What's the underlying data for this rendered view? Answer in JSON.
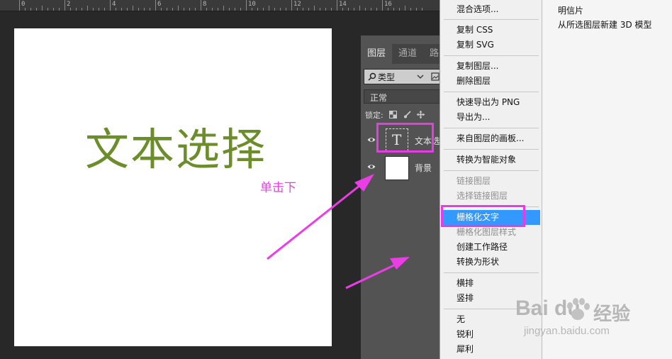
{
  "ruler": {
    "labels": [
      "0",
      "2",
      "4",
      "6",
      "8",
      "10",
      "12",
      "14",
      "16"
    ]
  },
  "canvas": {
    "text": "文本选择",
    "annotation": "单击下",
    "text_color": "#6b8e2a",
    "annotation_color": "#ea3de6"
  },
  "layers_panel": {
    "tabs": [
      "图层",
      "通道",
      "路"
    ],
    "filter_icon": "search-icon",
    "filter_label": "类型",
    "blend_mode": "正常",
    "lock_label": "锁定:",
    "layers": [
      {
        "name": "文本选",
        "kind": "text",
        "thumb_glyph": "T"
      },
      {
        "name": "背景",
        "kind": "image"
      }
    ]
  },
  "context_menu": {
    "groups": [
      [
        {
          "label": "混合选项...",
          "enabled": true
        }
      ],
      [
        {
          "label": "复制 CSS",
          "enabled": true
        },
        {
          "label": "复制 SVG",
          "enabled": true
        }
      ],
      [
        {
          "label": "复制图层...",
          "enabled": true
        },
        {
          "label": "删除图层",
          "enabled": true
        }
      ],
      [
        {
          "label": "快速导出为 PNG",
          "enabled": true
        },
        {
          "label": "导出为...",
          "enabled": true
        }
      ],
      [
        {
          "label": "来自图层的画板...",
          "enabled": true
        }
      ],
      [
        {
          "label": "转换为智能对象",
          "enabled": true
        }
      ],
      [
        {
          "label": "链接图层",
          "enabled": false
        },
        {
          "label": "选择链接图层",
          "enabled": false
        }
      ],
      [
        {
          "label": "栅格化文字",
          "enabled": true,
          "selected": true
        },
        {
          "label": "栅格化图层样式",
          "enabled": false
        },
        {
          "label": "创建工作路径",
          "enabled": true
        },
        {
          "label": "转换为形状",
          "enabled": true
        }
      ],
      [
        {
          "label": "横排",
          "enabled": true
        },
        {
          "label": "竖排",
          "enabled": true
        }
      ],
      [
        {
          "label": "无",
          "enabled": true
        },
        {
          "label": "锐利",
          "enabled": true
        },
        {
          "label": "犀利",
          "enabled": true
        }
      ]
    ]
  },
  "submenu": {
    "items": [
      "明信片",
      "从所选图层新建 3D 模型"
    ]
  },
  "watermark": {
    "logo": "Bai du",
    "name": "经验",
    "url": "jingyan.baidu.com"
  },
  "colors": {
    "highlight": "#e63be6",
    "menu_selected": "#3399ff"
  }
}
